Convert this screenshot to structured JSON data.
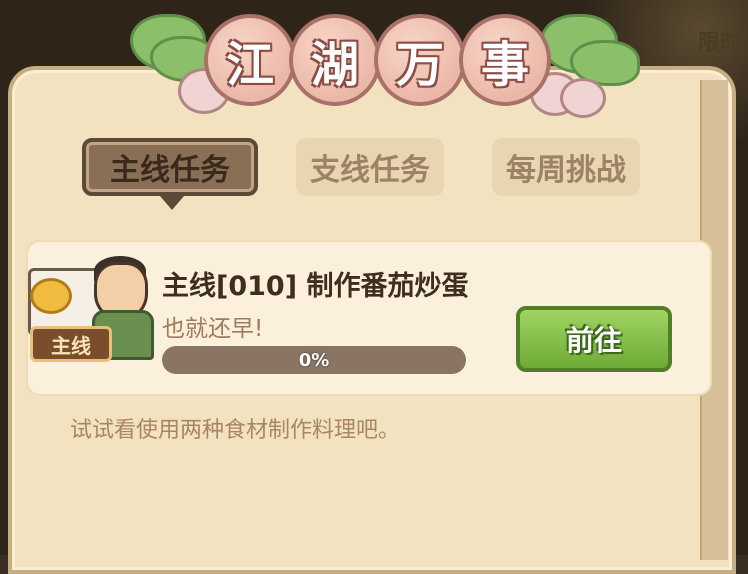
{
  "title": {
    "chars": [
      "江",
      "湖",
      "万",
      "事"
    ]
  },
  "background": {
    "top_right_text": "限时"
  },
  "tabs": [
    {
      "label": "主线任务",
      "active": true
    },
    {
      "label": "支线任务",
      "active": false
    },
    {
      "label": "每周挑战",
      "active": false
    }
  ],
  "quest": {
    "tag": "主线",
    "title": "主线[010] 制作番茄炒蛋",
    "subtitle": "也就还早!",
    "progress_value": 0,
    "progress_text": "0%",
    "button_label": "前往"
  },
  "hint": "试试看使用两种食材制作料理吧。",
  "colors": {
    "panel": "#f3e2bf",
    "active_tab": "#8a6f57",
    "button_green": "#7cbf4a",
    "title_bubble": "#ebb8a8"
  }
}
